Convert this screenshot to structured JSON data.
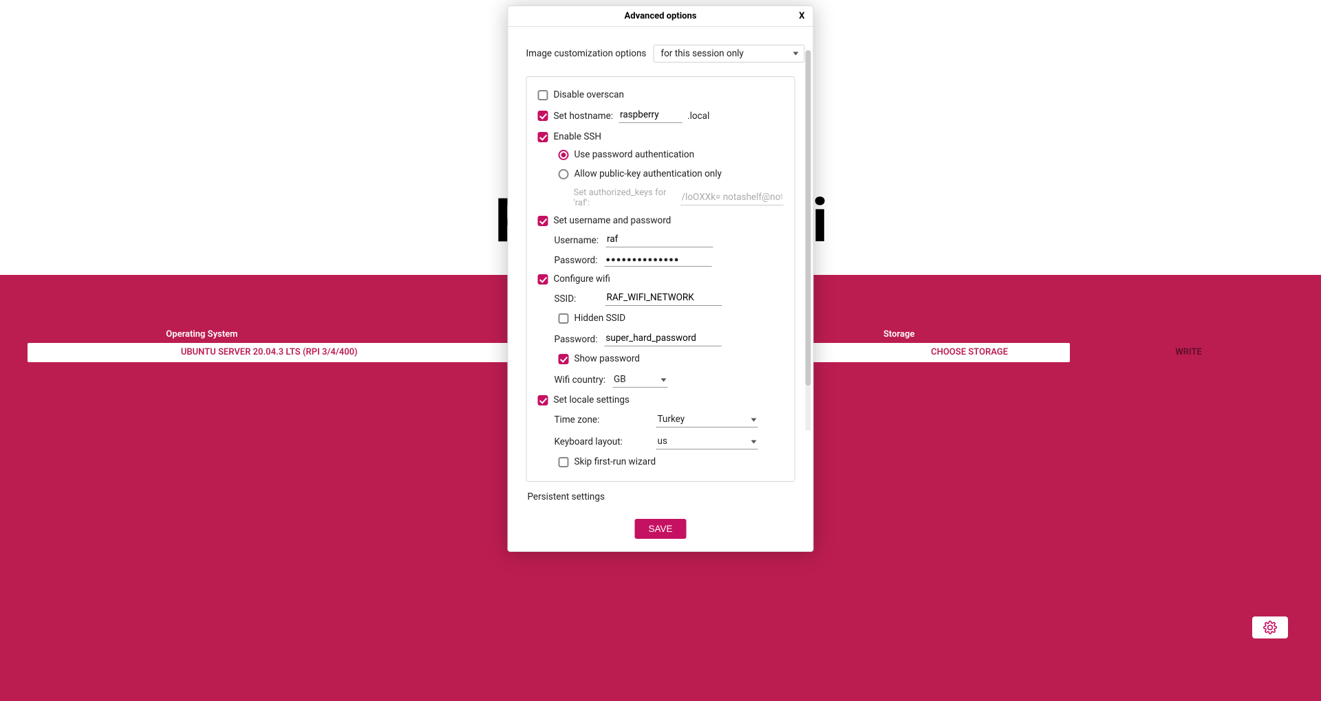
{
  "background": {
    "title": "Raspberry Pi",
    "columns": {
      "os_label": "Operating System",
      "storage_label": "Storage"
    },
    "buttons": {
      "os": "UBUNTU SERVER 20.04.3 LTS (RPI 3/4/400)",
      "storage": "CHOOSE STORAGE",
      "write": "WRITE"
    }
  },
  "modal": {
    "title": "Advanced options",
    "close": "X",
    "top": {
      "label": "Image customization options",
      "select_value": "for this session only"
    },
    "options": {
      "disable_overscan": {
        "label": "Disable overscan",
        "checked": false
      },
      "set_hostname": {
        "label": "Set hostname:",
        "checked": true,
        "value": "raspberry",
        "suffix": ".local"
      },
      "enable_ssh": {
        "label": "Enable SSH",
        "checked": true,
        "radio_password_label": "Use password authentication",
        "radio_key_label": "Allow public-key authentication only",
        "selected_radio": "password",
        "authkeys_label": "Set authorized_keys for 'raf':",
        "authkeys_value": "/loOXXk= notashelf@notapc"
      },
      "set_user": {
        "label": "Set username and password",
        "checked": true,
        "username_label": "Username:",
        "username_value": "raf",
        "password_label": "Password:",
        "password_masked": "●●●●●●●●●●●●●●"
      },
      "configure_wifi": {
        "label": "Configure wifi",
        "checked": true,
        "ssid_label": "SSID:",
        "ssid_value": "RAF_WIFI_NETWORK",
        "hidden_ssid_label": "Hidden SSID",
        "hidden_ssid_checked": false,
        "password_label": "Password:",
        "password_value": "super_hard_password",
        "show_password_label": "Show password",
        "show_password_checked": true,
        "wifi_country_label": "Wifi country:",
        "wifi_country_value": "GB"
      },
      "set_locale": {
        "label": "Set locale settings",
        "checked": true,
        "timezone_label": "Time zone:",
        "timezone_value": "Turkey",
        "keyboard_label": "Keyboard layout:",
        "keyboard_value": "us",
        "skip_wizard_label": "Skip first-run wizard",
        "skip_wizard_checked": false
      }
    },
    "persistent_label": "Persistent settings",
    "save": "SAVE"
  }
}
